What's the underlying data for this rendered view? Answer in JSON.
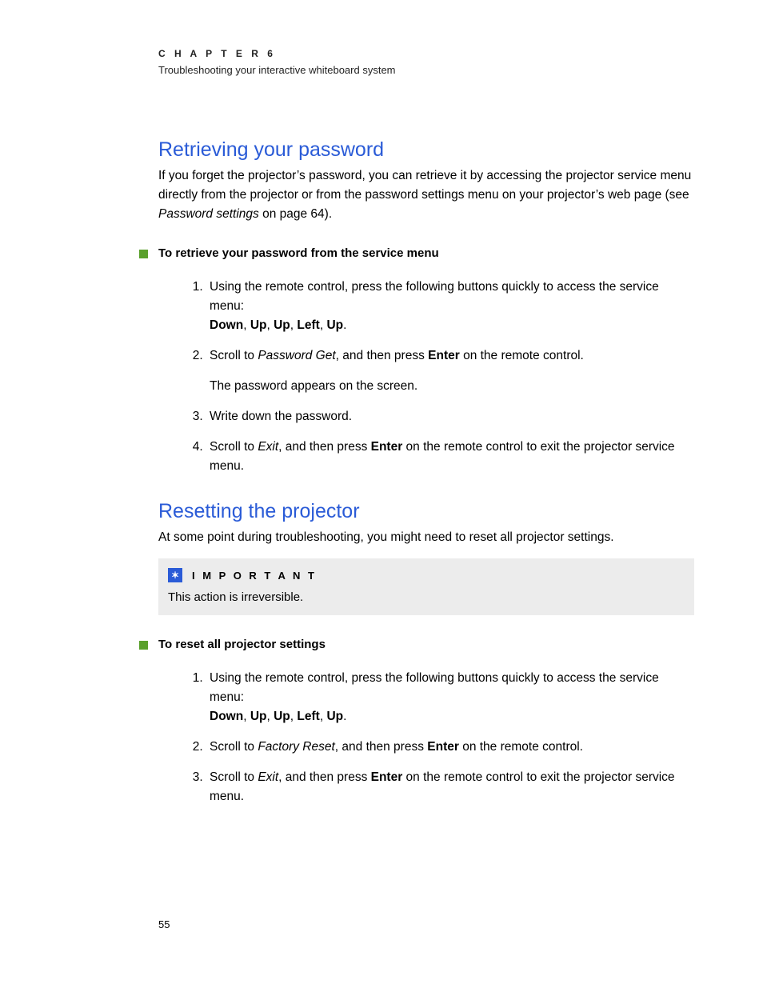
{
  "header": {
    "chapter": "C H A P T E R   6",
    "subtitle": "Troubleshooting your interactive whiteboard system"
  },
  "section1": {
    "title": "Retrieving your password",
    "intro_pre": "If you forget the projector’s password, you can retrieve it by accessing the projector service menu directly from the projector or from the password settings menu on your projector’s web page (see ",
    "intro_xref": "Password settings",
    "intro_post": " on page 64).",
    "proc_title": "To retrieve your password from the service menu",
    "step1_pre": "Using the remote control, press the following buttons quickly to access the service menu: ",
    "step1_b1": "Down",
    "step1_b2": "Up",
    "step1_b3": "Up",
    "step1_b4": "Left",
    "step1_b5": "Up",
    "step2_pre": "Scroll to ",
    "step2_i": "Password Get",
    "step2_mid": ",  and then press ",
    "step2_b": "Enter",
    "step2_post": " on the remote control.",
    "step2_sub": "The password appears on the screen.",
    "step3": "Write down the password.",
    "step4_pre": "Scroll to ",
    "step4_i": "Exit",
    "step4_mid": ",  and then press ",
    "step4_b": "Enter",
    "step4_post": " on the remote control to exit the projector service menu."
  },
  "section2": {
    "title": "Resetting the projector",
    "intro": "At some point during troubleshooting, you might need to reset all projector settings.",
    "important_label": "I M P O R T A N T",
    "important_body": "This action is irreversible.",
    "proc_title": "To reset all projector settings",
    "step1_pre": "Using the remote control, press the following buttons quickly to access the service menu: ",
    "step1_b1": "Down",
    "step1_b2": "Up",
    "step1_b3": "Up",
    "step1_b4": "Left",
    "step1_b5": "Up",
    "step2_pre": "Scroll to ",
    "step2_i": "Factory Reset",
    "step2_mid": ",  and then press ",
    "step2_b": "Enter",
    "step2_post": " on the remote control.",
    "step3_pre": "Scroll to ",
    "step3_i": "Exit",
    "step3_mid": ",  and then press ",
    "step3_b": "Enter",
    "step3_post": " on the remote control to exit the projector service menu."
  },
  "page_number": "55",
  "comma": ", ",
  "period": "."
}
